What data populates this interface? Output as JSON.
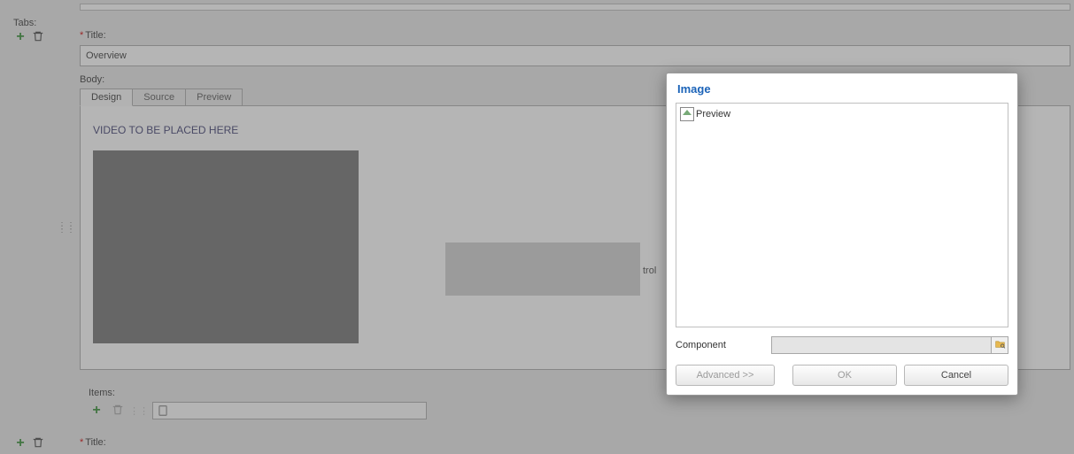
{
  "labels": {
    "tabs": "Tabs:",
    "title": "Title:",
    "body": "Body:",
    "items": "Items:",
    "title2": "Title:"
  },
  "fields": {
    "title_value": "Overview",
    "body_placeholder": "VIDEO TO BE PLACED HERE",
    "trailing_text": "trol"
  },
  "body_tabs": {
    "design": "Design",
    "source": "Source",
    "preview": "Preview"
  },
  "dialog": {
    "title": "Image",
    "preview_alt": "Preview",
    "component_label": "Component",
    "component_value": "",
    "advanced": "Advanced >>",
    "ok": "OK",
    "cancel": "Cancel"
  }
}
